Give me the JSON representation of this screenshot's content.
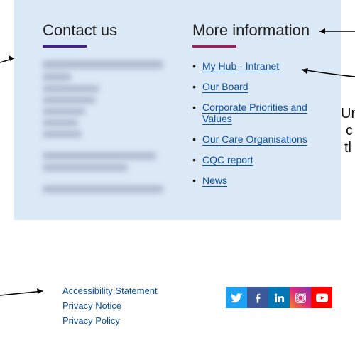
{
  "contact": {
    "heading": "Contact us"
  },
  "moreInfo": {
    "heading": "More information",
    "links": [
      "My Hub - Intranet",
      "Our Board",
      "Corporate Priorities and Values",
      "Our Care Organisations",
      "CQC report",
      "News"
    ]
  },
  "bottomLinks": [
    "Accessibility Statement",
    "Privacy Notice",
    "Privacy Policy"
  ],
  "social": {
    "twitter": "twitter-icon",
    "facebook": "facebook-icon",
    "linkedin": "linkedin-icon",
    "instagram": "instagram-icon",
    "youtube": "youtube-icon"
  },
  "annotations": {
    "right1": "Un",
    "right2": "c",
    "right3": "tl"
  }
}
